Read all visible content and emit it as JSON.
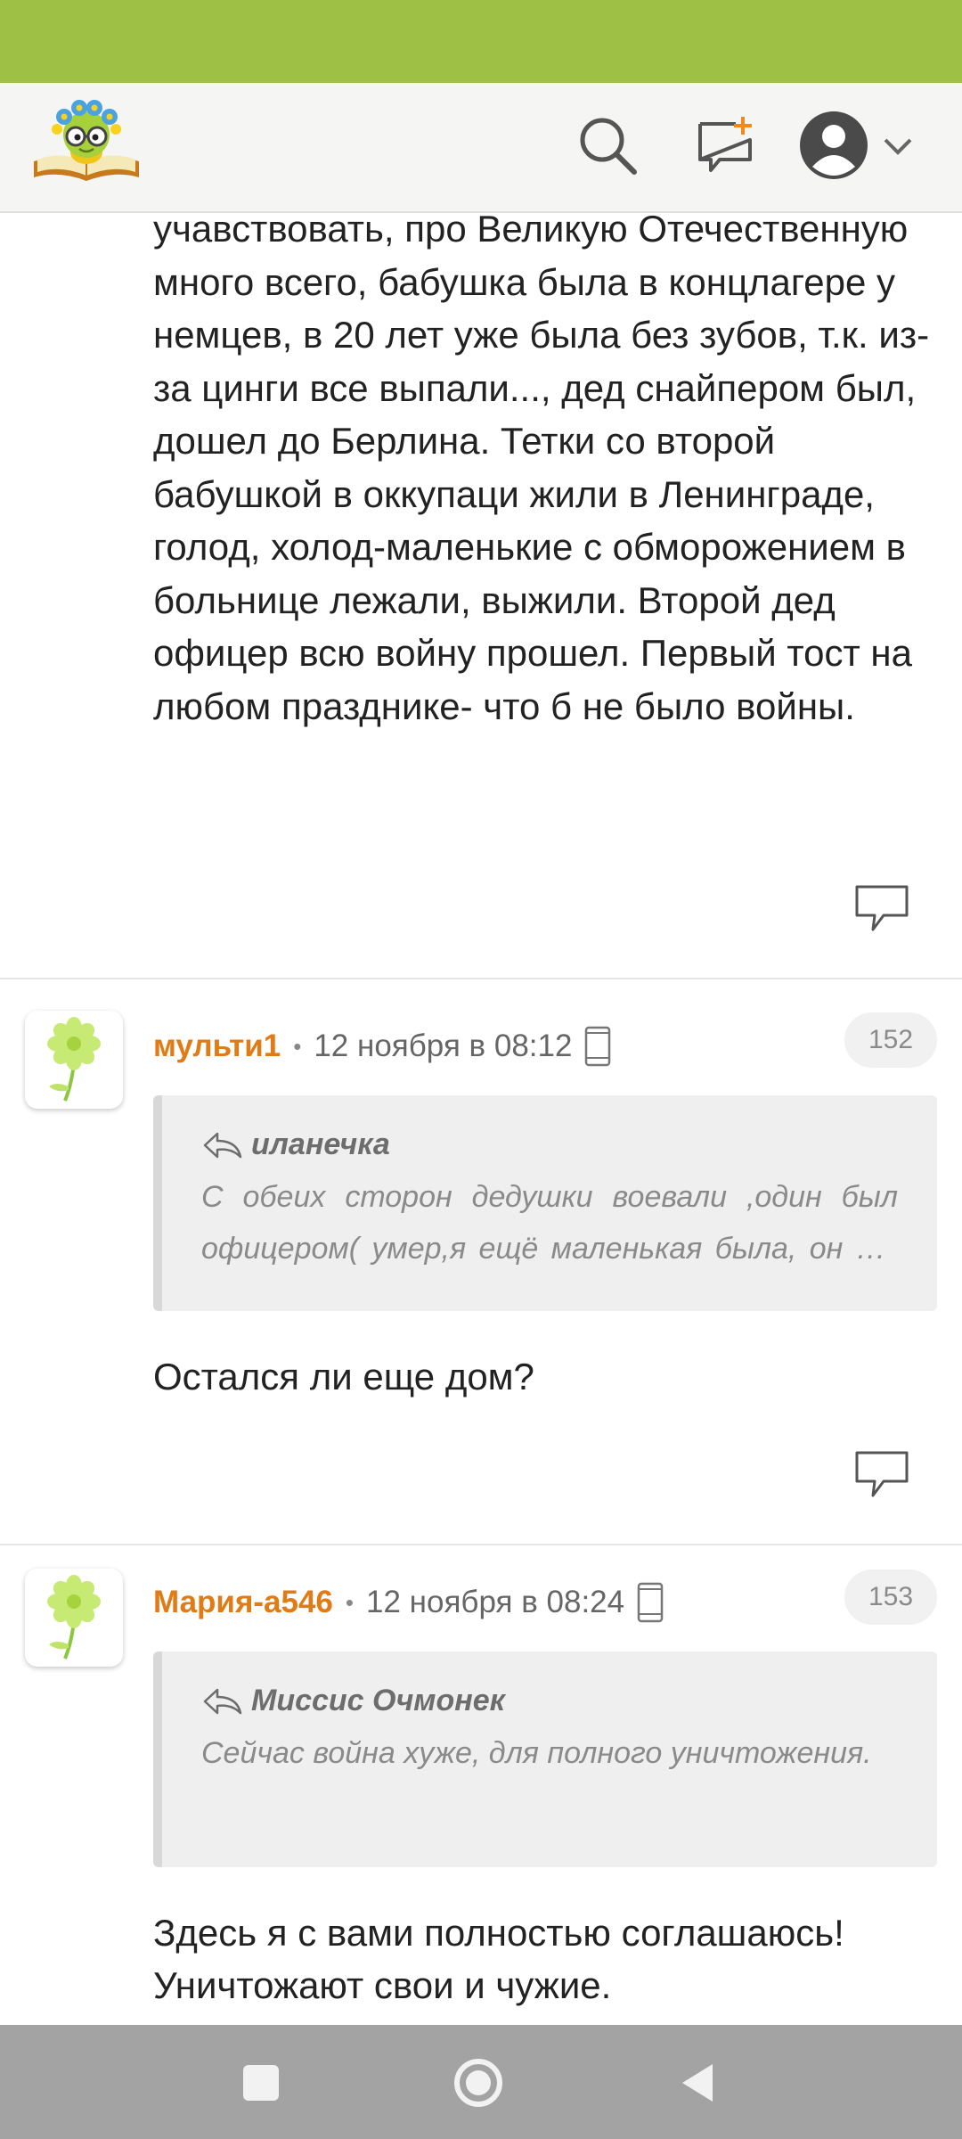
{
  "header": {
    "logo_name": "site-logo",
    "icons": [
      "search-icon",
      "new-message-icon",
      "user-avatar-icon",
      "chevron-down-icon"
    ]
  },
  "colors": {
    "status_bar": "#9dc045",
    "author": "#e07b15",
    "accent_plus": "#f08a1c"
  },
  "previous_comment": {
    "text": "учавствовать, про Великую Отечественную много всего, бабушка была в концлагере у немцев, в 20 лет уже была без зубов, т.к. из-за цинги все выпали..., дед снайпером был, дошел до Берлина. Тетки со второй бабушкой в оккупаци жили в Ленинграде, голод, холод-маленькие с обморожением в больнице лежали, выжили. Второй дед офицер всю войну прошел. Первый тост на любом празднике- что б не было войны."
  },
  "comments": [
    {
      "author": "мульти1",
      "separator": "•",
      "date": "12 ноября в 08:12",
      "number": "152",
      "quote_author": "иланечка",
      "quote_text": "С обеих сторон дедушки воевали ,один был офицером( умер,я ещё маленькая была, он от ран скончался), а другой пропал без вести",
      "text": "Остался ли еще дом?"
    },
    {
      "author": "Мария-а546",
      "separator": "•",
      "date": "12 ноября в 08:24",
      "number": "153",
      "quote_author": "Миссис Очмонек",
      "quote_text": "Сейчас война хуже, для полного уничтожения.",
      "text": "Здесь я с вами полностью соглашаюсь! Уничтожают свои и чужие."
    }
  ],
  "nav": {
    "icons": [
      "recent-apps-icon",
      "home-icon",
      "back-icon"
    ]
  }
}
